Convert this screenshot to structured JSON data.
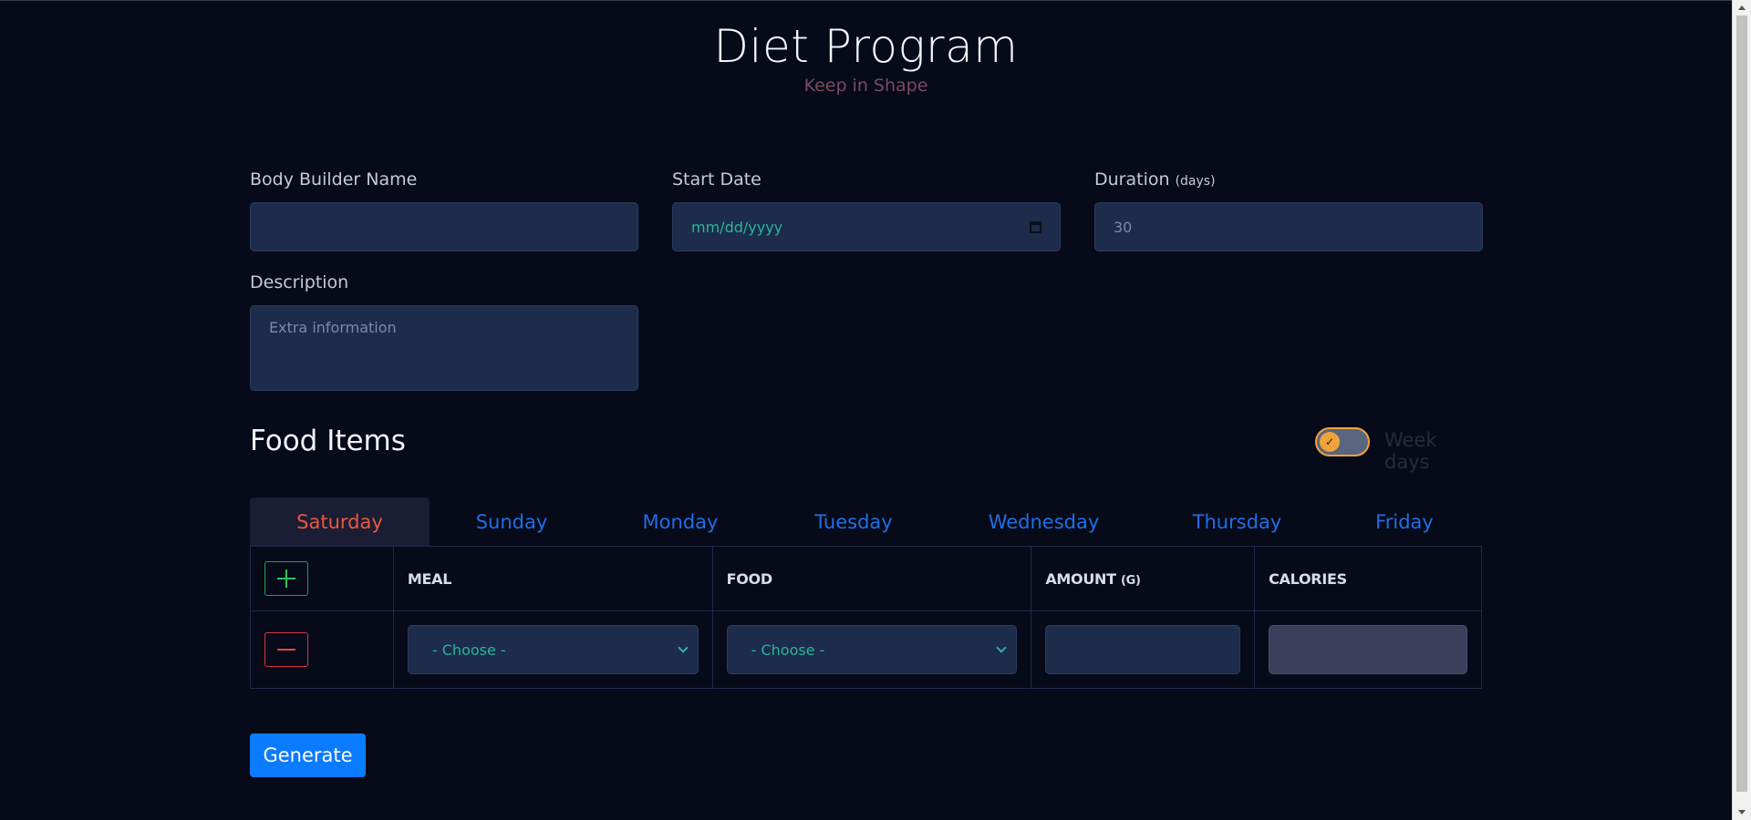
{
  "header": {
    "title": "Diet Program",
    "subtitle": "Keep in Shape"
  },
  "form": {
    "name_label": "Body Builder Name",
    "name_value": "",
    "start_date_label": "Start Date",
    "start_date_placeholder": "mm/dd/yyyy",
    "duration_label": "Duration",
    "duration_unit": "(days)",
    "duration_placeholder": "30",
    "description_label": "Description",
    "description_placeholder": "Extra information"
  },
  "food_items": {
    "title": "Food Items",
    "week_days_label": "Week days",
    "week_days_toggle": true,
    "tabs": [
      {
        "label": "Saturday",
        "active": true
      },
      {
        "label": "Sunday",
        "active": false
      },
      {
        "label": "Monday",
        "active": false
      },
      {
        "label": "Tuesday",
        "active": false
      },
      {
        "label": "Wednesday",
        "active": false
      },
      {
        "label": "Thursday",
        "active": false
      },
      {
        "label": "Friday",
        "active": false
      }
    ],
    "table": {
      "headers": {
        "meal": "MEAL",
        "food": "FOOD",
        "amount": "AMOUNT",
        "amount_unit": "(G)",
        "calories": "CALORIES"
      },
      "rows": [
        {
          "meal": "- Choose -",
          "food": "- Choose -",
          "amount": "",
          "calories": ""
        }
      ]
    }
  },
  "actions": {
    "generate_label": "Generate"
  },
  "colors": {
    "background": "#070a19",
    "accent": "#0b7bff",
    "active_tab": "#e9573e",
    "tab_text": "#1f6fe6",
    "toggle": "#f0a33a"
  },
  "icons": {
    "add": "plus-icon",
    "remove": "minus-icon",
    "toggle_check": "check-icon",
    "calendar": "calendar-icon",
    "dropdown": "chevron-down-icon"
  }
}
